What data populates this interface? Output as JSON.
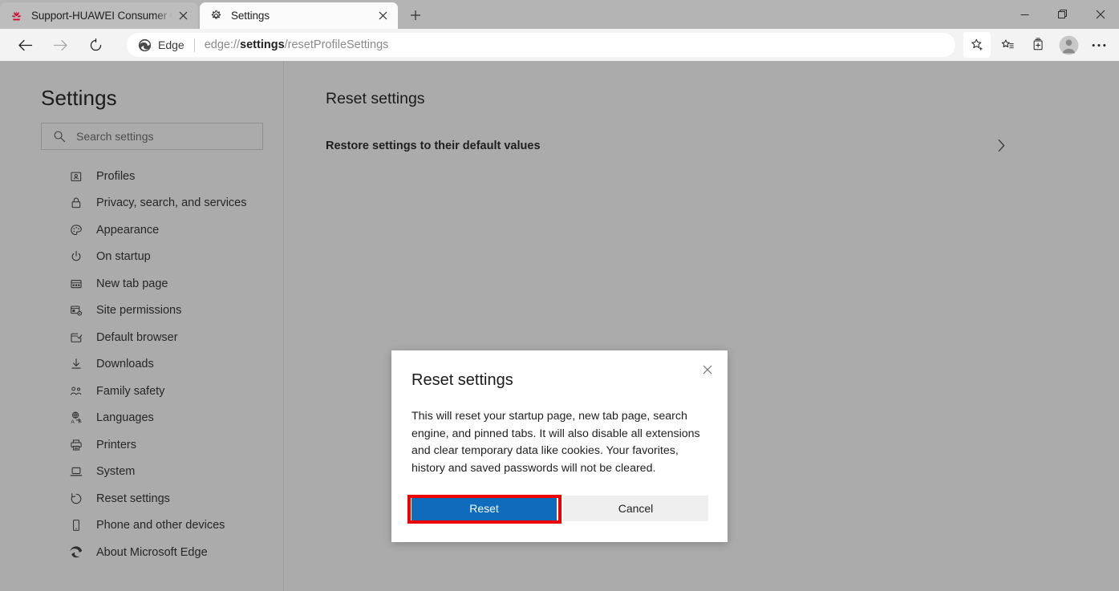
{
  "window": {
    "controls": [
      {
        "name": "minimize",
        "glyph": "minimize-icon"
      },
      {
        "name": "restore",
        "glyph": "restore-icon"
      },
      {
        "name": "close",
        "glyph": "close-icon"
      }
    ]
  },
  "tabs": [
    {
      "title": "Support-HUAWEI Consumer Offi",
      "favicon": "huawei-logo-icon",
      "active": false
    },
    {
      "title": "Settings",
      "favicon": "gear-icon",
      "active": true
    }
  ],
  "tabstrip": {
    "new_tab_label": "+",
    "close_label": "×"
  },
  "toolbar": {
    "back_icon": "back-arrow-icon",
    "forward_icon": "forward-arrow-icon",
    "refresh_icon": "refresh-icon",
    "edge_badge_label": "Edge",
    "url_prefix": "edge://",
    "url_bold": "settings",
    "url_suffix": "/resetProfileSettings",
    "icons": [
      "add-favorite-icon",
      "favorites-list-icon",
      "collections-icon",
      "profile-avatar-icon",
      "more-options-icon"
    ]
  },
  "sidebar": {
    "title": "Settings",
    "search": {
      "placeholder": "Search settings",
      "icon": "search-icon",
      "value": ""
    },
    "items": [
      {
        "label": "Profiles",
        "icon": "profile-card-icon"
      },
      {
        "label": "Privacy, search, and services",
        "icon": "lock-icon"
      },
      {
        "label": "Appearance",
        "icon": "palette-icon"
      },
      {
        "label": "On startup",
        "icon": "power-icon"
      },
      {
        "label": "New tab page",
        "icon": "new-tab-page-icon"
      },
      {
        "label": "Site permissions",
        "icon": "site-permissions-icon"
      },
      {
        "label": "Default browser",
        "icon": "default-browser-icon"
      },
      {
        "label": "Downloads",
        "icon": "download-arrow-icon"
      },
      {
        "label": "Family safety",
        "icon": "family-icon"
      },
      {
        "label": "Languages",
        "icon": "languages-icon"
      },
      {
        "label": "Printers",
        "icon": "printer-icon"
      },
      {
        "label": "System",
        "icon": "system-icon"
      },
      {
        "label": "Reset settings",
        "icon": "reset-circular-arrow-icon"
      },
      {
        "label": "Phone and other devices",
        "icon": "phone-icon"
      },
      {
        "label": "About Microsoft Edge",
        "icon": "edge-logo-icon"
      }
    ]
  },
  "main": {
    "title": "Reset settings",
    "restore_row": {
      "label": "Restore settings to their default values",
      "chevron": "chevron-right-icon"
    }
  },
  "dialog": {
    "title": "Reset settings",
    "body": "This will reset your startup page, new tab page, search engine, and pinned tabs. It will also disable all extensions and clear temporary data like cookies. Your favorites, history and saved passwords will not be cleared.",
    "primary_button": "Reset",
    "secondary_button": "Cancel",
    "close_icon": "close-icon"
  },
  "annotation": {
    "target": "Reset",
    "color": "#EE0000"
  },
  "colors": {
    "page_background": "#ABABAB",
    "tabstrip": "#B4B4B4",
    "active_tab": "#FBFBFB",
    "inactive_tab": "#BDBDBD",
    "toolbar": "#F3F3F3",
    "omnibox": "#FFFFFF",
    "dialog_background": "#FFFFFF",
    "primary_button": "#0F6CBD",
    "secondary_button": "#EFEFEF",
    "annotation_red": "#EE0000",
    "huawei_red": "#CF0A2C"
  }
}
